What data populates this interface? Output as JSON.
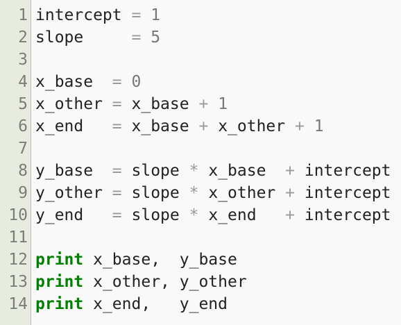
{
  "editor": {
    "colors": {
      "background": "#f9f9f9",
      "gutter": "#e8ebe0",
      "keyword": "#008000",
      "operator": "#9a9a9a",
      "number": "#777777",
      "identifier": "#222222",
      "line_number": "#7b7e76"
    },
    "lines": [
      {
        "number": "1",
        "tokens": [
          {
            "t": "id",
            "v": "intercept"
          },
          {
            "t": "ws",
            "v": " "
          },
          {
            "t": "op",
            "v": "="
          },
          {
            "t": "ws",
            "v": " "
          },
          {
            "t": "num",
            "v": "1"
          }
        ]
      },
      {
        "number": "2",
        "tokens": [
          {
            "t": "id",
            "v": "slope"
          },
          {
            "t": "ws",
            "v": "     "
          },
          {
            "t": "op",
            "v": "="
          },
          {
            "t": "ws",
            "v": " "
          },
          {
            "t": "num",
            "v": "5"
          }
        ]
      },
      {
        "number": "3",
        "tokens": []
      },
      {
        "number": "4",
        "tokens": [
          {
            "t": "id",
            "v": "x_base"
          },
          {
            "t": "ws",
            "v": "  "
          },
          {
            "t": "op",
            "v": "="
          },
          {
            "t": "ws",
            "v": " "
          },
          {
            "t": "num",
            "v": "0"
          }
        ]
      },
      {
        "number": "5",
        "tokens": [
          {
            "t": "id",
            "v": "x_other"
          },
          {
            "t": "ws",
            "v": " "
          },
          {
            "t": "op",
            "v": "="
          },
          {
            "t": "ws",
            "v": " "
          },
          {
            "t": "id",
            "v": "x_base"
          },
          {
            "t": "ws",
            "v": " "
          },
          {
            "t": "op",
            "v": "+"
          },
          {
            "t": "ws",
            "v": " "
          },
          {
            "t": "num",
            "v": "1"
          }
        ]
      },
      {
        "number": "6",
        "tokens": [
          {
            "t": "id",
            "v": "x_end"
          },
          {
            "t": "ws",
            "v": "   "
          },
          {
            "t": "op",
            "v": "="
          },
          {
            "t": "ws",
            "v": " "
          },
          {
            "t": "id",
            "v": "x_base"
          },
          {
            "t": "ws",
            "v": " "
          },
          {
            "t": "op",
            "v": "+"
          },
          {
            "t": "ws",
            "v": " "
          },
          {
            "t": "id",
            "v": "x_other"
          },
          {
            "t": "ws",
            "v": " "
          },
          {
            "t": "op",
            "v": "+"
          },
          {
            "t": "ws",
            "v": " "
          },
          {
            "t": "num",
            "v": "1"
          }
        ]
      },
      {
        "number": "7",
        "tokens": []
      },
      {
        "number": "8",
        "tokens": [
          {
            "t": "id",
            "v": "y_base"
          },
          {
            "t": "ws",
            "v": "  "
          },
          {
            "t": "op",
            "v": "="
          },
          {
            "t": "ws",
            "v": " "
          },
          {
            "t": "id",
            "v": "slope"
          },
          {
            "t": "ws",
            "v": " "
          },
          {
            "t": "op",
            "v": "*"
          },
          {
            "t": "ws",
            "v": " "
          },
          {
            "t": "id",
            "v": "x_base"
          },
          {
            "t": "ws",
            "v": "  "
          },
          {
            "t": "op",
            "v": "+"
          },
          {
            "t": "ws",
            "v": " "
          },
          {
            "t": "id",
            "v": "intercept"
          }
        ]
      },
      {
        "number": "9",
        "tokens": [
          {
            "t": "id",
            "v": "y_other"
          },
          {
            "t": "ws",
            "v": " "
          },
          {
            "t": "op",
            "v": "="
          },
          {
            "t": "ws",
            "v": " "
          },
          {
            "t": "id",
            "v": "slope"
          },
          {
            "t": "ws",
            "v": " "
          },
          {
            "t": "op",
            "v": "*"
          },
          {
            "t": "ws",
            "v": " "
          },
          {
            "t": "id",
            "v": "x_other"
          },
          {
            "t": "ws",
            "v": " "
          },
          {
            "t": "op",
            "v": "+"
          },
          {
            "t": "ws",
            "v": " "
          },
          {
            "t": "id",
            "v": "intercept"
          }
        ]
      },
      {
        "number": "10",
        "tokens": [
          {
            "t": "id",
            "v": "y_end"
          },
          {
            "t": "ws",
            "v": "   "
          },
          {
            "t": "op",
            "v": "="
          },
          {
            "t": "ws",
            "v": " "
          },
          {
            "t": "id",
            "v": "slope"
          },
          {
            "t": "ws",
            "v": " "
          },
          {
            "t": "op",
            "v": "*"
          },
          {
            "t": "ws",
            "v": " "
          },
          {
            "t": "id",
            "v": "x_end"
          },
          {
            "t": "ws",
            "v": "   "
          },
          {
            "t": "op",
            "v": "+"
          },
          {
            "t": "ws",
            "v": " "
          },
          {
            "t": "id",
            "v": "intercept"
          }
        ]
      },
      {
        "number": "11",
        "tokens": []
      },
      {
        "number": "12",
        "tokens": [
          {
            "t": "kw",
            "v": "print"
          },
          {
            "t": "ws",
            "v": " "
          },
          {
            "t": "id",
            "v": "x_base,"
          },
          {
            "t": "ws",
            "v": "  "
          },
          {
            "t": "id",
            "v": "y_base"
          }
        ]
      },
      {
        "number": "13",
        "tokens": [
          {
            "t": "kw",
            "v": "print"
          },
          {
            "t": "ws",
            "v": " "
          },
          {
            "t": "id",
            "v": "x_other,"
          },
          {
            "t": "ws",
            "v": " "
          },
          {
            "t": "id",
            "v": "y_other"
          }
        ]
      },
      {
        "number": "14",
        "tokens": [
          {
            "t": "kw",
            "v": "print"
          },
          {
            "t": "ws",
            "v": " "
          },
          {
            "t": "id",
            "v": "x_end,"
          },
          {
            "t": "ws",
            "v": "   "
          },
          {
            "t": "id",
            "v": "y_end"
          }
        ]
      }
    ]
  }
}
